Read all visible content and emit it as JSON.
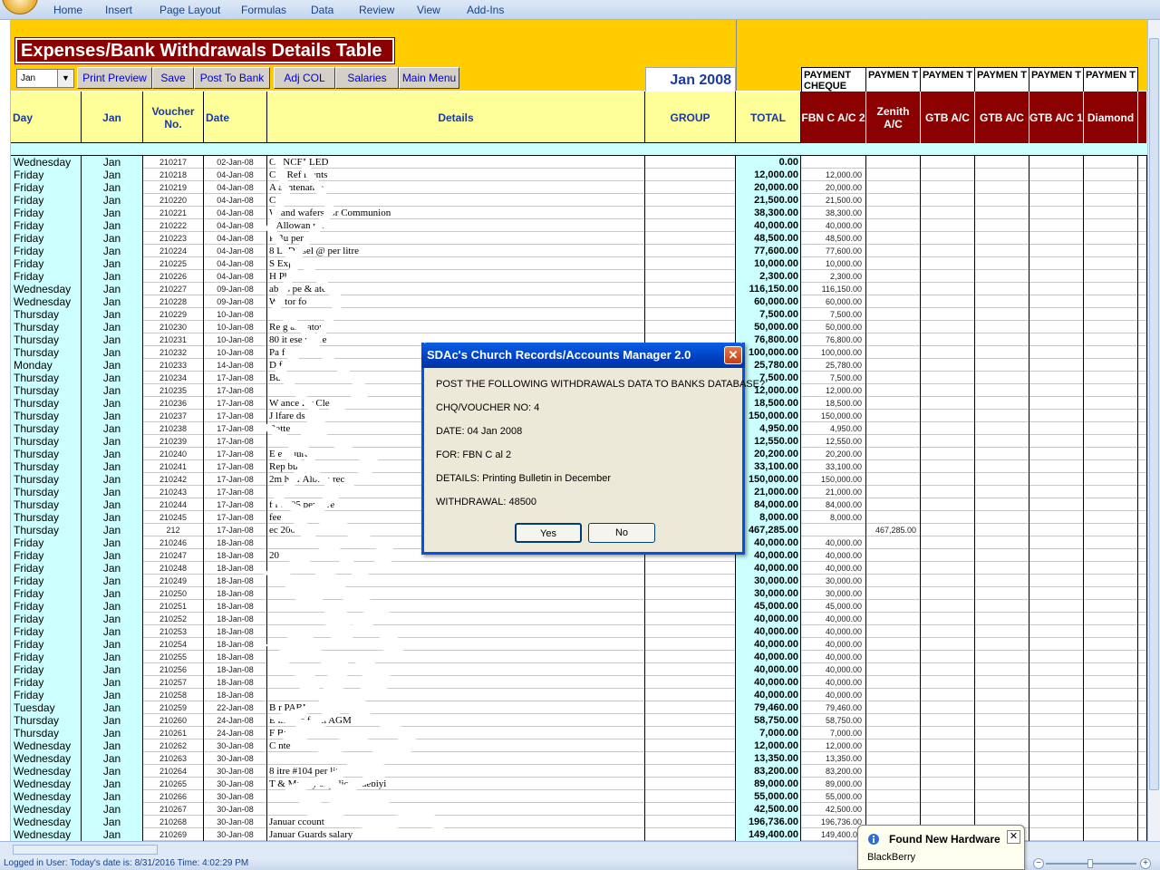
{
  "ribbon": {
    "tabs": [
      "Home",
      "Insert",
      "Page Layout",
      "Formulas",
      "Data",
      "Review",
      "View",
      "Add-Ins"
    ]
  },
  "sheet": {
    "title": "Expenses/Bank Withdrawals Details Table",
    "month_select": "Jan",
    "buttons": {
      "print_preview": "Print Preview",
      "save": "Save",
      "post_to_bank": "Post To Bank",
      "adj_col": "Adj COL",
      "salaries": "Salaries",
      "main_menu": "Main Menu"
    },
    "period_label": "Jan 2008",
    "payment_headers": [
      "PAYMENT CHEQUE",
      "PAYMEN T",
      "PAYMEN T",
      "PAYMEN T",
      "PAYMEN T",
      "PAYMEN T"
    ],
    "columns": {
      "day": "Day",
      "month": "Jan",
      "voucher": "Voucher No.",
      "date": "Date",
      "details": "Details",
      "group": "GROUP",
      "total": "TOTAL"
    },
    "bank_columns": [
      "FBN C A/C 2",
      "Zenith A/C",
      "GTB A/C",
      "GTB A/C",
      "GTB A/C 1",
      "Diamond"
    ]
  },
  "rows": [
    {
      "n": "1",
      "day": "Wednesday",
      "mon": "Jan",
      "vou": "210217",
      "date": "02-Jan-08",
      "det": "CANCELLED",
      "tot": "0.00",
      "b1": "",
      "b2": ""
    },
    {
      "n": "1",
      "day": "Friday",
      "mon": "Jan",
      "vou": "210218",
      "date": "04-Jan-08",
      "det": "C  ir Ref   ments",
      "tot": "12,000.00",
      "b1": "12,000.00",
      "b2": ""
    },
    {
      "n": "1",
      "day": "Friday",
      "mon": "Jan",
      "vou": "210219",
      "date": "04-Jan-08",
      "det": "A     al   ntenance",
      "tot": "20,000.00",
      "b1": "20,000.00",
      "b2": ""
    },
    {
      "n": "1",
      "day": "Friday",
      "mon": "Jan",
      "vou": "210220",
      "date": "04-Jan-08",
      "det": "C",
      "tot": "21,500.00",
      "b1": "21,500.00",
      "b2": ""
    },
    {
      "n": "1",
      "day": "Friday",
      "mon": "Jan",
      "vou": "210221",
      "date": "04-Jan-08",
      "det": "W   and wafers for Communion",
      "tot": "38,300.00",
      "b1": "38,300.00",
      "b2": ""
    },
    {
      "n": "1",
      "day": "Friday",
      "mon": "Jan",
      "vou": "210222",
      "date": "04-Jan-08",
      "det": "2    Allowan        rse",
      "tot": "40,000.00",
      "b1": "40,000.00",
      "b2": ""
    },
    {
      "n": "1",
      "day": "Friday",
      "mon": "Jan",
      "vou": "210223",
      "date": "04-Jan-08",
      "det": "P     Bu          per",
      "tot": "48,500.00",
      "b1": "48,500.00",
      "b2": ""
    },
    {
      "n": "1",
      "day": "Friday",
      "mon": "Jan",
      "vou": "210224",
      "date": "04-Jan-08",
      "det": "8   Li    Diesel @    per litre",
      "tot": "77,600.00",
      "b1": "77,600.00",
      "b2": ""
    },
    {
      "n": "1",
      "day": "Friday",
      "mon": "Jan",
      "vou": "210225",
      "date": "04-Jan-08",
      "det": "S    Expe",
      "tot": "10,000.00",
      "b1": "10,000.00",
      "b2": ""
    },
    {
      "n": "1",
      "day": "Friday",
      "mon": "Jan",
      "vou": "210226",
      "date": "04-Jan-08",
      "det": "H    Ph",
      "tot": "2,300.00",
      "b1": "2,300.00",
      "b2": ""
    },
    {
      "n": "1",
      "day": "Wednesday",
      "mon": "Jan",
      "vou": "210227",
      "date": "09-Jan-08",
      "det": "     ab     us   pe & ater",
      "tot": "116,150.00",
      "b1": "116,150.00",
      "b2": ""
    },
    {
      "n": "1",
      "day": "Wednesday",
      "mon": "Jan",
      "vou": "210228",
      "date": "09-Jan-08",
      "det": "Wa       tor fo",
      "tot": "60,000.00",
      "b1": "60,000.00",
      "b2": ""
    },
    {
      "n": "1",
      "day": "Thursday",
      "mon": "Jan",
      "vou": "210229",
      "date": "10-Jan-08",
      "det": "",
      "tot": "7,500.00",
      "b1": "7,500.00",
      "b2": ""
    },
    {
      "n": "1",
      "day": "Thursday",
      "mon": "Jan",
      "vou": "210230",
      "date": "10-Jan-08",
      "det": "Re        g          alte   ator",
      "tot": "50,000.00",
      "b1": "50,000.00",
      "b2": ""
    },
    {
      "n": "1",
      "day": "Thursday",
      "mon": "Jan",
      "vou": "210231",
      "date": "10-Jan-08",
      "det": "80     it     ese           r litre",
      "tot": "76,800.00",
      "b1": "76,800.00",
      "b2": ""
    },
    {
      "n": "1",
      "day": "Thursday",
      "mon": "Jan",
      "vou": "210232",
      "date": "10-Jan-08",
      "det": "Pa        f",
      "tot": "100,000.00",
      "b1": "100,000.00",
      "b2": ""
    },
    {
      "n": "1",
      "day": "Monday",
      "mon": "Jan",
      "vou": "210233",
      "date": "14-Jan-08",
      "det": "D     f",
      "tot": "25,780.00",
      "b1": "25,780.00",
      "b2": ""
    },
    {
      "n": "1",
      "day": "Thursday",
      "mon": "Jan",
      "vou": "210234",
      "date": "17-Jan-08",
      "det": "Bu",
      "tot": "7,500.00",
      "b1": "7,500.00",
      "b2": ""
    },
    {
      "n": "1",
      "day": "Thursday",
      "mon": "Jan",
      "vou": "210235",
      "date": "17-Jan-08",
      "det": "",
      "tot": "12,000.00",
      "b1": "12,000.00",
      "b2": ""
    },
    {
      "n": "1",
      "day": "Thursday",
      "mon": "Jan",
      "vou": "210236",
      "date": "17-Jan-08",
      "det": "W           ance for Cle",
      "tot": "18,500.00",
      "b1": "18,500.00",
      "b2": ""
    },
    {
      "n": "1",
      "day": "Thursday",
      "mon": "Jan",
      "vou": "210237",
      "date": "17-Jan-08",
      "det": "J          lfare  ds",
      "tot": "150,000.00",
      "b1": "150,000.00",
      "b2": ""
    },
    {
      "n": "1",
      "day": "Thursday",
      "mon": "Jan",
      "vou": "210238",
      "date": "17-Jan-08",
      "det": "      Batte",
      "tot": "4,950.00",
      "b1": "4,950.00",
      "b2": ""
    },
    {
      "n": "1",
      "day": "Thursday",
      "mon": "Jan",
      "vou": "210239",
      "date": "17-Jan-08",
      "det": "",
      "tot": "12,550.00",
      "b1": "12,550.00",
      "b2": ""
    },
    {
      "n": "1",
      "day": "Thursday",
      "mon": "Jan",
      "vou": "210240",
      "date": "17-Jan-08",
      "det": "E          e Church",
      "tot": "20,200.00",
      "b1": "20,200.00",
      "b2": ""
    },
    {
      "n": "1",
      "day": "Thursday",
      "mon": "Jan",
      "vou": "210241",
      "date": "17-Jan-08",
      "det": "Rep          bus",
      "tot": "33,100.00",
      "b1": "33,100.00",
      "b2": ""
    },
    {
      "n": "1",
      "day": "Thursday",
      "mon": "Jan",
      "vou": "210242",
      "date": "17-Jan-08",
      "det": "2m         hoir Album rec",
      "tot": "150,000.00",
      "b1": "150,000.00",
      "b2": ""
    },
    {
      "n": "1",
      "day": "Thursday",
      "mon": "Jan",
      "vou": "210243",
      "date": "17-Jan-08",
      "det": "",
      "tot": "21,000.00",
      "b1": "21,000.00",
      "b2": ""
    },
    {
      "n": "1",
      "day": "Thursday",
      "mon": "Jan",
      "vou": "210244",
      "date": "17-Jan-08",
      "det": "f   f      #105 per litre",
      "tot": "84,000.00",
      "b1": "84,000.00",
      "b2": ""
    },
    {
      "n": "1",
      "day": "Thursday",
      "mon": "Jan",
      "vou": "210245",
      "date": "17-Jan-08",
      "det": "         fee",
      "tot": "8,000.00",
      "b1": "8,000.00",
      "b2": ""
    },
    {
      "n": "1",
      "day": "Thursday",
      "mon": "Jan",
      "vou": "212",
      "date": "17-Jan-08",
      "det": "     ec  2007",
      "tot": "467,285.00",
      "b1": "",
      "b2": "467,285.00"
    },
    {
      "n": "1",
      "day": "Friday",
      "mon": "Jan",
      "vou": "210246",
      "date": "18-Jan-08",
      "det": "",
      "tot": "40,000.00",
      "b1": "40,000.00",
      "b2": ""
    },
    {
      "n": "1",
      "day": "Friday",
      "mon": "Jan",
      "vou": "210247",
      "date": "18-Jan-08",
      "det": "20",
      "tot": "40,000.00",
      "b1": "40,000.00",
      "b2": ""
    },
    {
      "n": "1",
      "day": "Friday",
      "mon": "Jan",
      "vou": "210248",
      "date": "18-Jan-08",
      "det": "",
      "tot": "40,000.00",
      "b1": "40,000.00",
      "b2": ""
    },
    {
      "n": "1",
      "day": "Friday",
      "mon": "Jan",
      "vou": "210249",
      "date": "18-Jan-08",
      "det": "",
      "tot": "30,000.00",
      "b1": "30,000.00",
      "b2": ""
    },
    {
      "n": "1",
      "day": "Friday",
      "mon": "Jan",
      "vou": "210250",
      "date": "18-Jan-08",
      "det": "",
      "tot": "30,000.00",
      "b1": "30,000.00",
      "b2": ""
    },
    {
      "n": "1",
      "day": "Friday",
      "mon": "Jan",
      "vou": "210251",
      "date": "18-Jan-08",
      "det": "",
      "tot": "45,000.00",
      "b1": "45,000.00",
      "b2": ""
    },
    {
      "n": "1",
      "day": "Friday",
      "mon": "Jan",
      "vou": "210252",
      "date": "18-Jan-08",
      "det": "",
      "tot": "40,000.00",
      "b1": "40,000.00",
      "b2": ""
    },
    {
      "n": "1",
      "day": "Friday",
      "mon": "Jan",
      "vou": "210253",
      "date": "18-Jan-08",
      "det": "",
      "tot": "40,000.00",
      "b1": "40,000.00",
      "b2": ""
    },
    {
      "n": "1",
      "day": "Friday",
      "mon": "Jan",
      "vou": "210254",
      "date": "18-Jan-08",
      "det": "",
      "tot": "40,000.00",
      "b1": "40,000.00",
      "b2": ""
    },
    {
      "n": "1",
      "day": "Friday",
      "mon": "Jan",
      "vou": "210255",
      "date": "18-Jan-08",
      "det": "",
      "tot": "40,000.00",
      "b1": "40,000.00",
      "b2": ""
    },
    {
      "n": "1",
      "day": "Friday",
      "mon": "Jan",
      "vou": "210256",
      "date": "18-Jan-08",
      "det": "",
      "tot": "40,000.00",
      "b1": "40,000.00",
      "b2": ""
    },
    {
      "n": "1",
      "day": "Friday",
      "mon": "Jan",
      "vou": "210257",
      "date": "18-Jan-08",
      "det": "",
      "tot": "40,000.00",
      "b1": "40,000.00",
      "b2": ""
    },
    {
      "n": "1",
      "day": "Friday",
      "mon": "Jan",
      "vou": "210258",
      "date": "18-Jan-08",
      "det": "",
      "tot": "40,000.00",
      "b1": "40,000.00",
      "b2": ""
    },
    {
      "n": "1",
      "day": "Tuesday",
      "mon": "Jan",
      "vou": "210259",
      "date": "22-Jan-08",
      "det": "B      r PABI",
      "tot": "79,460.00",
      "b1": "79,460.00",
      "b2": ""
    },
    {
      "n": "1",
      "day": "Thursday",
      "mon": "Jan",
      "vou": "210260",
      "date": "24-Jan-08",
      "det": "E    ining     s for    h AGM",
      "tot": "58,750.00",
      "b1": "58,750.00",
      "b2": ""
    },
    {
      "n": "1",
      "day": "Thursday",
      "mon": "Jan",
      "vou": "210261",
      "date": "24-Jan-08",
      "det": "F    Bus",
      "tot": "7,000.00",
      "b1": "7,000.00",
      "b2": ""
    },
    {
      "n": "1",
      "day": "Wednesday",
      "mon": "Jan",
      "vou": "210262",
      "date": "30-Jan-08",
      "det": "C     nte",
      "tot": "12,000.00",
      "b1": "12,000.00",
      "b2": ""
    },
    {
      "n": "1",
      "day": "Wednesday",
      "mon": "Jan",
      "vou": "210263",
      "date": "30-Jan-08",
      "det": "",
      "tot": "13,350.00",
      "b1": "13,350.00",
      "b2": ""
    },
    {
      "n": "1",
      "day": "Wednesday",
      "mon": "Jan",
      "vou": "210264",
      "date": "30-Jan-08",
      "det": "8      itre       #104 per litr",
      "tot": "83,200.00",
      "b1": "83,200.00",
      "b2": ""
    },
    {
      "n": "1",
      "day": "Wednesday",
      "mon": "Jan",
      "vou": "210265",
      "date": "30-Jan-08",
      "det": "T          & Mnthly supplies       Adebiyi",
      "tot": "89,000.00",
      "b1": "89,000.00",
      "b2": ""
    },
    {
      "n": "1",
      "day": "Wednesday",
      "mon": "Jan",
      "vou": "210266",
      "date": "30-Jan-08",
      "det": "",
      "tot": "55,000.00",
      "b1": "55,000.00",
      "b2": ""
    },
    {
      "n": "1",
      "day": "Wednesday",
      "mon": "Jan",
      "vou": "210267",
      "date": "30-Jan-08",
      "det": "",
      "tot": "42,500.00",
      "b1": "42,500.00",
      "b2": ""
    },
    {
      "n": "1",
      "day": "Wednesday",
      "mon": "Jan",
      "vou": "210268",
      "date": "30-Jan-08",
      "det": "Januar         ccount",
      "tot": "196,736.00",
      "b1": "196,736.00",
      "b2": ""
    },
    {
      "n": "1",
      "day": "Wednesday",
      "mon": "Jan",
      "vou": "210269",
      "date": "30-Jan-08",
      "det": "Januar     Guards salary",
      "tot": "149,400.00",
      "b1": "149,400.00",
      "b2": ""
    }
  ],
  "dialog": {
    "title": "SDAc's Church Records/Accounts Manager 2.0",
    "line1": "POST THE FOLLOWING WITHDRAWALS DATA TO BANKS DATABASE?",
    "line2": "CHQ/VOUCHER NO: 4",
    "line3": "DATE: 04 Jan 2008",
    "line4": "FOR: FBN C    al   2",
    "line5": "DETAILS: Printing Bulletin in December",
    "line6": "WITHDRAWAL: 48500",
    "yes": "Yes",
    "no": "No",
    "close_glyph": "✕"
  },
  "status": {
    "text": "Logged in User:                   Today's date is: 8/31/2016 Time: 4:02:29 PM"
  },
  "toast": {
    "title": "Found New Hardware",
    "body": "BlackBerry",
    "close_glyph": "✕"
  }
}
